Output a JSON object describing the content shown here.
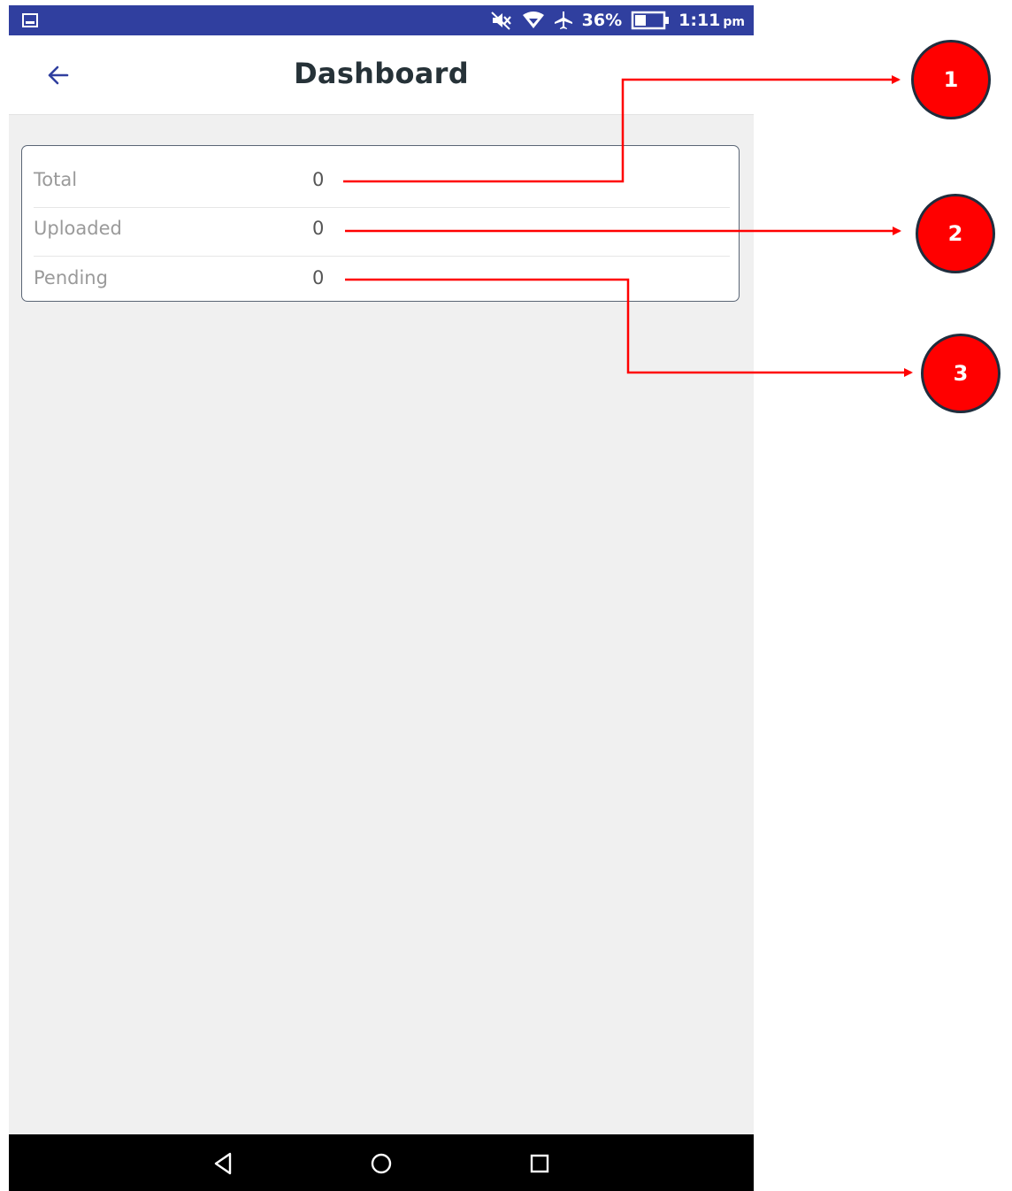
{
  "status_bar": {
    "battery_percent": "36%",
    "time": "1:11",
    "ampm": "pm",
    "background_color": "#303f9f",
    "icons": [
      "gallery-icon",
      "mute-icon",
      "wifi-icon",
      "airplane-icon",
      "battery-icon"
    ]
  },
  "app_bar": {
    "title": "Dashboard",
    "back_icon": "arrow-left-icon",
    "accent_color": "#303f9f"
  },
  "stats": [
    {
      "label": "Total",
      "value": "0"
    },
    {
      "label": "Uploaded",
      "value": "0"
    },
    {
      "label": "Pending",
      "value": "0"
    }
  ],
  "nav_bar": {
    "icons": [
      "nav-back-icon",
      "nav-home-icon",
      "nav-recent-icon"
    ]
  },
  "annotations": {
    "callouts": [
      "1",
      "2",
      "3"
    ],
    "color": "#ff0000"
  }
}
